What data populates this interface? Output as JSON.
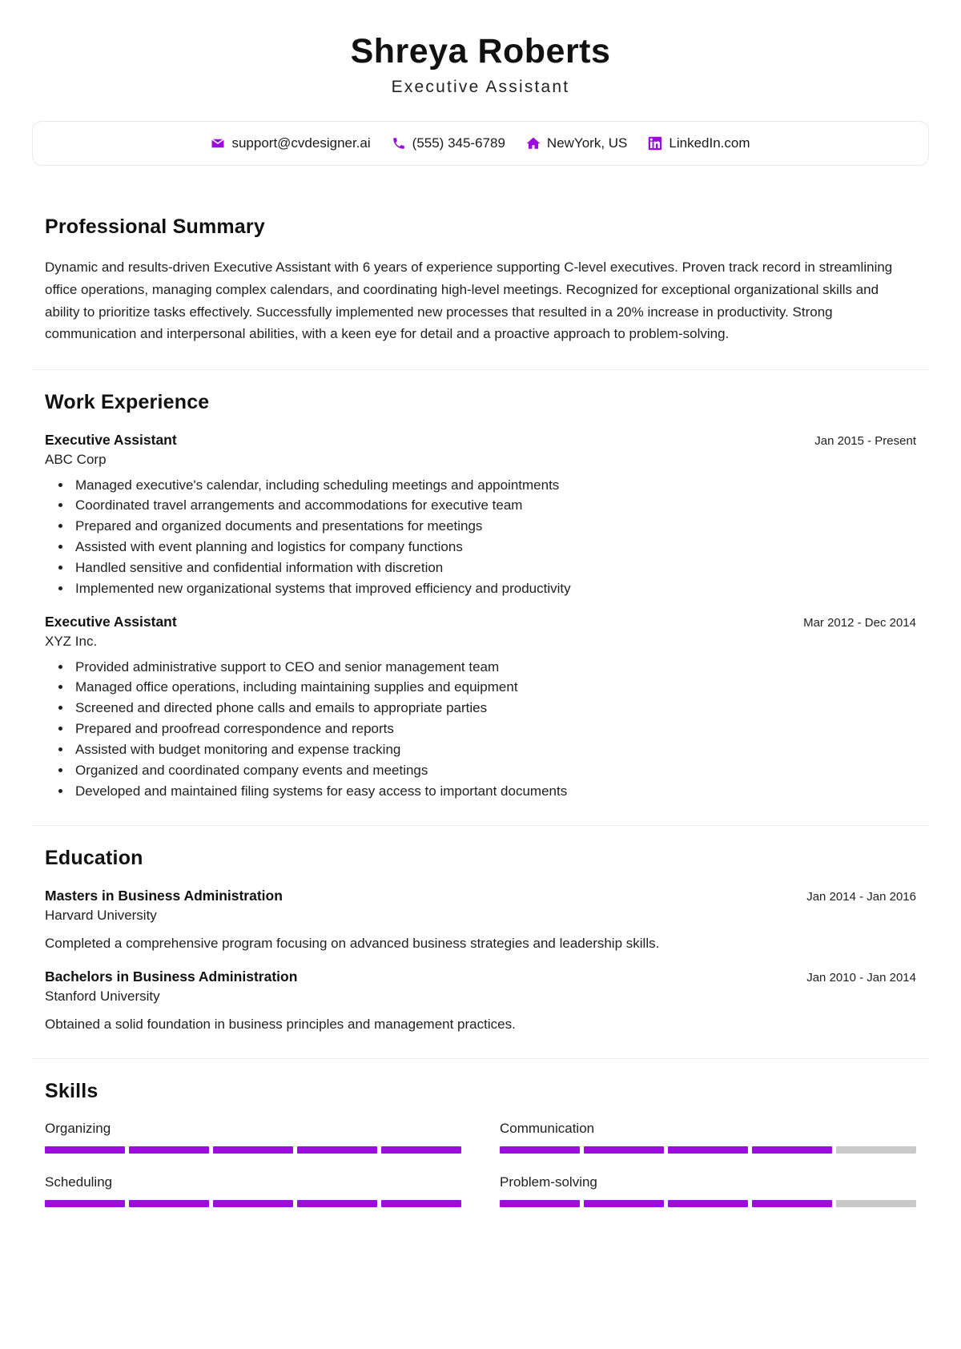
{
  "header": {
    "name": "Shreya Roberts",
    "job_title": "Executive Assistant"
  },
  "accent_color": "#9A0CE0",
  "contact": {
    "items": [
      {
        "icon": "envelope-icon",
        "text": "support@cvdesigner.ai"
      },
      {
        "icon": "phone-icon",
        "text": "(555) 345-6789"
      },
      {
        "icon": "home-icon",
        "text": "NewYork, US"
      },
      {
        "icon": "linkedin-icon",
        "text": "LinkedIn.com"
      }
    ]
  },
  "summary": {
    "title": "Professional Summary",
    "text": "Dynamic and results-driven Executive Assistant with 6 years of experience supporting C-level executives. Proven track record in streamlining office operations, managing complex calendars, and coordinating high-level meetings. Recognized for exceptional organizational skills and ability to prioritize tasks effectively. Successfully implemented new processes that resulted in a 20% increase in productivity. Strong communication and interpersonal abilities, with a keen eye for detail and a proactive approach to problem-solving."
  },
  "work": {
    "title": "Work Experience",
    "entries": [
      {
        "role": "Executive Assistant",
        "org": "ABC Corp",
        "date": "Jan 2015 - Present",
        "bullets": [
          "Managed executive's calendar, including scheduling meetings and appointments",
          "Coordinated travel arrangements and accommodations for executive team",
          "Prepared and organized documents and presentations for meetings",
          "Assisted with event planning and logistics for company functions",
          "Handled sensitive and confidential information with discretion",
          "Implemented new organizational systems that improved efficiency and productivity"
        ]
      },
      {
        "role": "Executive Assistant",
        "org": "XYZ Inc.",
        "date": "Mar 2012 - Dec 2014",
        "bullets": [
          "Provided administrative support to CEO and senior management team",
          "Managed office operations, including maintaining supplies and equipment",
          "Screened and directed phone calls and emails to appropriate parties",
          "Prepared and proofread correspondence and reports",
          "Assisted with budget monitoring and expense tracking",
          "Organized and coordinated company events and meetings",
          "Developed and maintained filing systems for easy access to important documents"
        ]
      }
    ]
  },
  "education": {
    "title": "Education",
    "entries": [
      {
        "degree": "Masters in Business Administration",
        "school": "Harvard University",
        "date": "Jan 2014 - Jan 2016",
        "description": "Completed a comprehensive program focusing on advanced business strategies and leadership skills."
      },
      {
        "degree": "Bachelors in Business Administration",
        "school": "Stanford University",
        "date": "Jan 2010 - Jan 2014",
        "description": "Obtained a solid foundation in business principles and management practices."
      }
    ]
  },
  "skills": {
    "title": "Skills",
    "segments_total": 5,
    "items": [
      {
        "name": "Organizing",
        "filled": 5
      },
      {
        "name": "Communication",
        "filled": 4
      },
      {
        "name": "Scheduling",
        "filled": 5
      },
      {
        "name": "Problem-solving",
        "filled": 4
      }
    ]
  }
}
